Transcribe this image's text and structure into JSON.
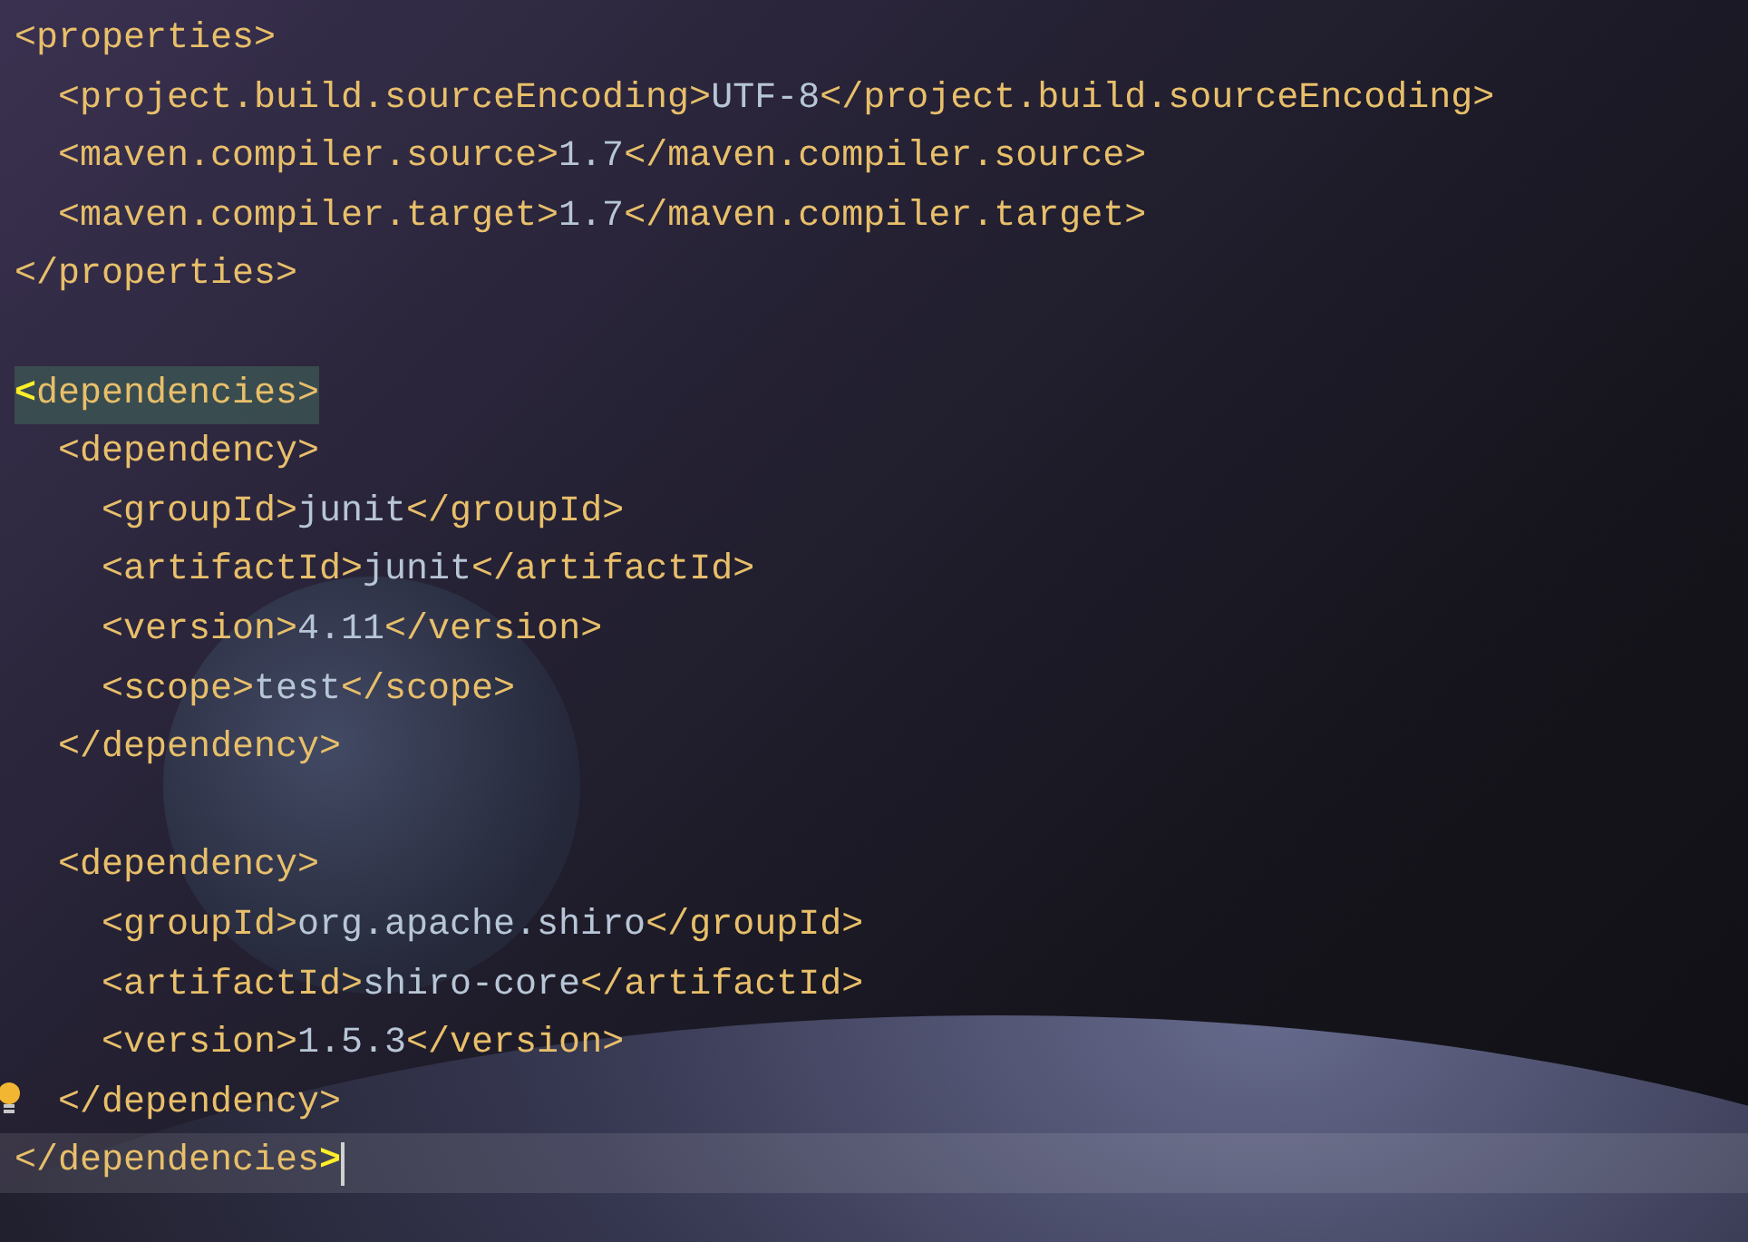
{
  "editor": {
    "lines": [
      {
        "kind": "code",
        "current": false,
        "tokens": [
          {
            "kind": "tag",
            "text": "<properties>"
          }
        ],
        "children": [
          {
            "kind": "code",
            "current": false,
            "tokens": [
              {
                "kind": "tag",
                "text": "<project.build.sourceEncoding>"
              },
              {
                "kind": "value",
                "text": "UTF-8"
              },
              {
                "kind": "tag",
                "text": "</project.build.sourceEncoding>"
              }
            ]
          },
          {
            "kind": "code",
            "current": false,
            "tokens": [
              {
                "kind": "tag",
                "text": "<maven.compiler.source>"
              },
              {
                "kind": "value",
                "text": "1.7"
              },
              {
                "kind": "tag",
                "text": "</maven.compiler.source>"
              }
            ]
          },
          {
            "kind": "code",
            "current": false,
            "tokens": [
              {
                "kind": "tag",
                "text": "<maven.compiler.target>"
              },
              {
                "kind": "value",
                "text": "1.7"
              },
              {
                "kind": "tag",
                "text": "</maven.compiler.target>"
              }
            ]
          }
        ]
      },
      {
        "kind": "code",
        "current": false,
        "tokens": [
          {
            "kind": "tag",
            "text": "</properties>"
          }
        ]
      },
      {
        "kind": "blank"
      },
      {
        "kind": "code",
        "current": false,
        "tokens": [
          {
            "kind": "match",
            "text": "<"
          },
          {
            "kind": "match-tag",
            "text": "dependencies>"
          }
        ],
        "children": [
          {
            "kind": "code",
            "current": false,
            "tokens": [
              {
                "kind": "tag",
                "text": "<dependency>"
              }
            ],
            "children": [
              {
                "kind": "code",
                "current": false,
                "tokens": [
                  {
                    "kind": "tag",
                    "text": "<groupId>"
                  },
                  {
                    "kind": "value",
                    "text": "junit"
                  },
                  {
                    "kind": "tag",
                    "text": "</groupId>"
                  }
                ]
              },
              {
                "kind": "code",
                "current": false,
                "tokens": [
                  {
                    "kind": "tag",
                    "text": "<artifactId>"
                  },
                  {
                    "kind": "value",
                    "text": "junit"
                  },
                  {
                    "kind": "tag",
                    "text": "</artifactId>"
                  }
                ]
              },
              {
                "kind": "code",
                "current": false,
                "tokens": [
                  {
                    "kind": "tag",
                    "text": "<version>"
                  },
                  {
                    "kind": "value",
                    "text": "4.11"
                  },
                  {
                    "kind": "tag",
                    "text": "</version>"
                  }
                ]
              },
              {
                "kind": "code",
                "current": false,
                "tokens": [
                  {
                    "kind": "tag",
                    "text": "<scope>"
                  },
                  {
                    "kind": "value",
                    "text": "test"
                  },
                  {
                    "kind": "tag",
                    "text": "</scope>"
                  }
                ]
              }
            ]
          },
          {
            "kind": "code",
            "current": false,
            "tokens": [
              {
                "kind": "tag",
                "text": "</dependency>"
              }
            ]
          },
          {
            "kind": "blank"
          },
          {
            "kind": "code",
            "current": false,
            "tokens": [
              {
                "kind": "tag",
                "text": "<dependency>"
              }
            ],
            "children": [
              {
                "kind": "code",
                "current": false,
                "tokens": [
                  {
                    "kind": "tag",
                    "text": "<groupId>"
                  },
                  {
                    "kind": "value",
                    "text": "org.apache.shiro"
                  },
                  {
                    "kind": "tag",
                    "text": "</groupId>"
                  }
                ]
              },
              {
                "kind": "code",
                "current": false,
                "tokens": [
                  {
                    "kind": "tag",
                    "text": "<artifactId>"
                  },
                  {
                    "kind": "value",
                    "text": "shiro-core"
                  },
                  {
                    "kind": "tag",
                    "text": "</artifactId>"
                  }
                ]
              },
              {
                "kind": "code",
                "current": false,
                "tokens": [
                  {
                    "kind": "tag",
                    "text": "<version>"
                  },
                  {
                    "kind": "value",
                    "text": "1.5.3"
                  },
                  {
                    "kind": "tag",
                    "text": "</version>"
                  }
                ]
              }
            ]
          },
          {
            "kind": "code",
            "current": false,
            "bulb": true,
            "tokens": [
              {
                "kind": "tag",
                "text": "</dependency>"
              }
            ]
          }
        ]
      },
      {
        "kind": "code",
        "current": true,
        "tokens": [
          {
            "kind": "tag",
            "text": "</dependencies"
          },
          {
            "kind": "match",
            "text": ">"
          }
        ]
      }
    ]
  }
}
